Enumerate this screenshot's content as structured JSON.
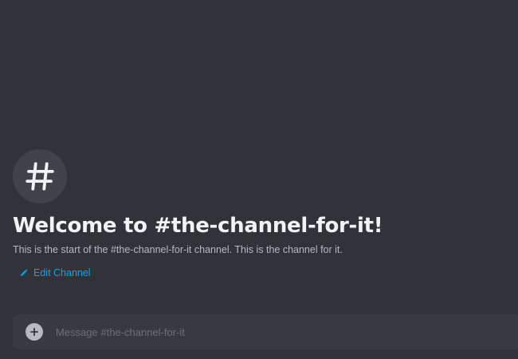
{
  "channel": {
    "name": "the-channel-for-it",
    "icon": "hash-icon"
  },
  "welcome": {
    "title": "Welcome to #the-channel-for-it!",
    "description": "This is the start of the #the-channel-for-it channel. This is the channel for it.",
    "edit_label": "Edit Channel",
    "edit_icon": "pencil-icon"
  },
  "composer": {
    "placeholder": "Message #the-channel-for-it",
    "value": "",
    "attach_icon": "plus-circle-icon"
  },
  "colors": {
    "background": "#313338",
    "composer_background": "#383a40",
    "icon_circle": "#41434a",
    "title": "#f2f3f5",
    "muted_text": "#b5bac1",
    "link": "#00a8fc"
  }
}
